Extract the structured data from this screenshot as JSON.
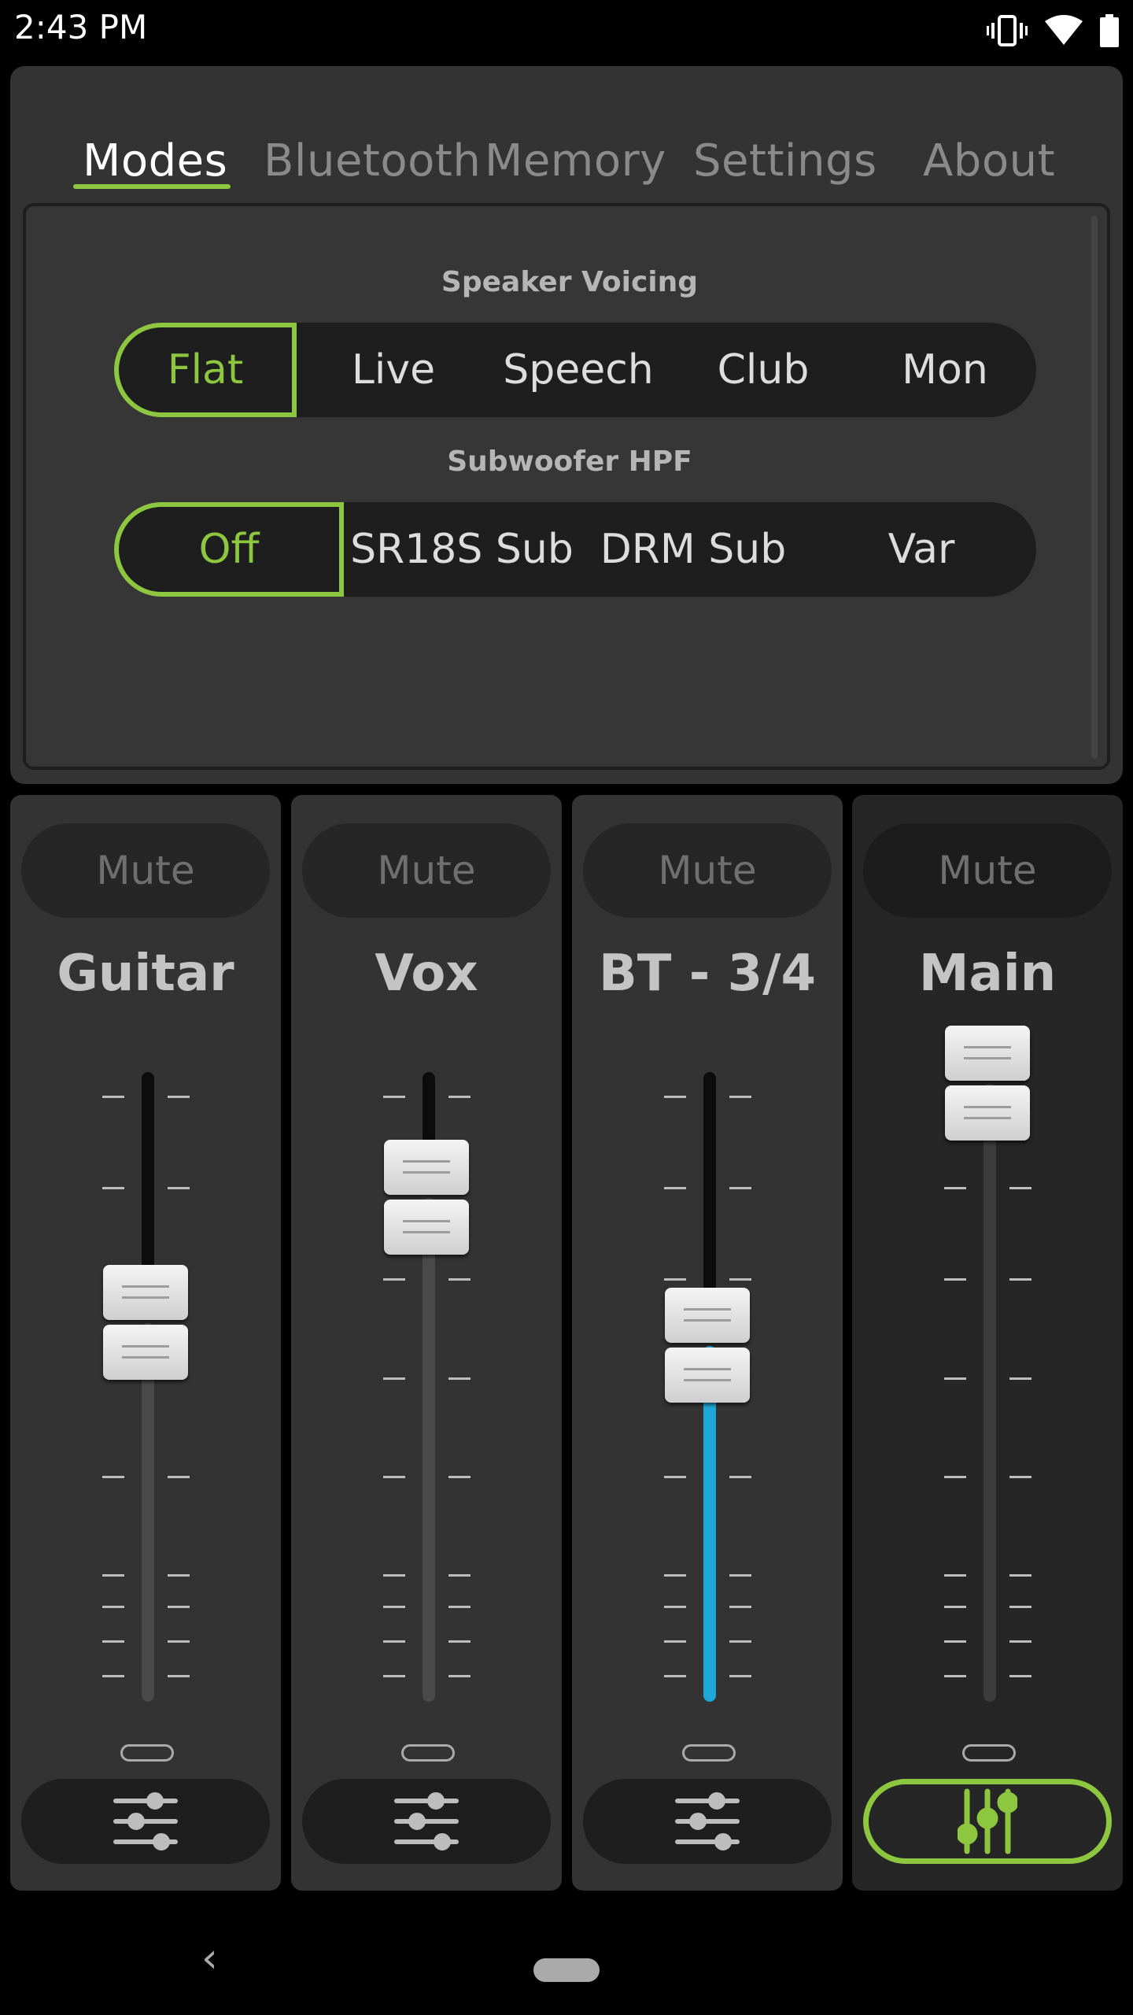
{
  "status_bar": {
    "time": "2:43 PM",
    "icons": [
      "vibrate-icon",
      "wifi-icon",
      "battery-icon"
    ]
  },
  "tabs": [
    {
      "label": "Modes",
      "active": true
    },
    {
      "label": "Bluetooth",
      "active": false
    },
    {
      "label": "Memory",
      "active": false
    },
    {
      "label": "Settings",
      "active": false
    },
    {
      "label": "About",
      "active": false
    }
  ],
  "modes": {
    "speaker_voicing": {
      "label": "Speaker Voicing",
      "options": [
        "Flat",
        "Live",
        "Speech",
        "Club",
        "Mon"
      ],
      "selected": "Flat"
    },
    "subwoofer_hpf": {
      "label": "Subwoofer HPF",
      "options": [
        "Off",
        "SR18S Sub",
        "DRM Sub",
        "Var"
      ],
      "selected": "Off"
    }
  },
  "channels": [
    {
      "name": "Guitar",
      "mute_label": "Mute",
      "fader_level": 0.56,
      "fill_color": "",
      "eq_icon": "eq-sliders-icon"
    },
    {
      "name": "Vox",
      "mute_label": "Mute",
      "fader_level": 0.78,
      "fill_color": "",
      "eq_icon": "eq-sliders-icon"
    },
    {
      "name": "BT - 3/4",
      "mute_label": "Mute",
      "fader_level": 0.52,
      "fill_color": "#1ea8d8",
      "eq_icon": "eq-sliders-icon"
    },
    {
      "name": "Main",
      "mute_label": "Mute",
      "fader_level": 0.98,
      "fill_color": "",
      "eq_icon": "mixer-faders-icon",
      "selected": true
    }
  ],
  "colors": {
    "accent": "#8dc63f",
    "bt_fill": "#1ea8d8"
  },
  "nav_bar": {
    "back_glyph": "‹"
  }
}
